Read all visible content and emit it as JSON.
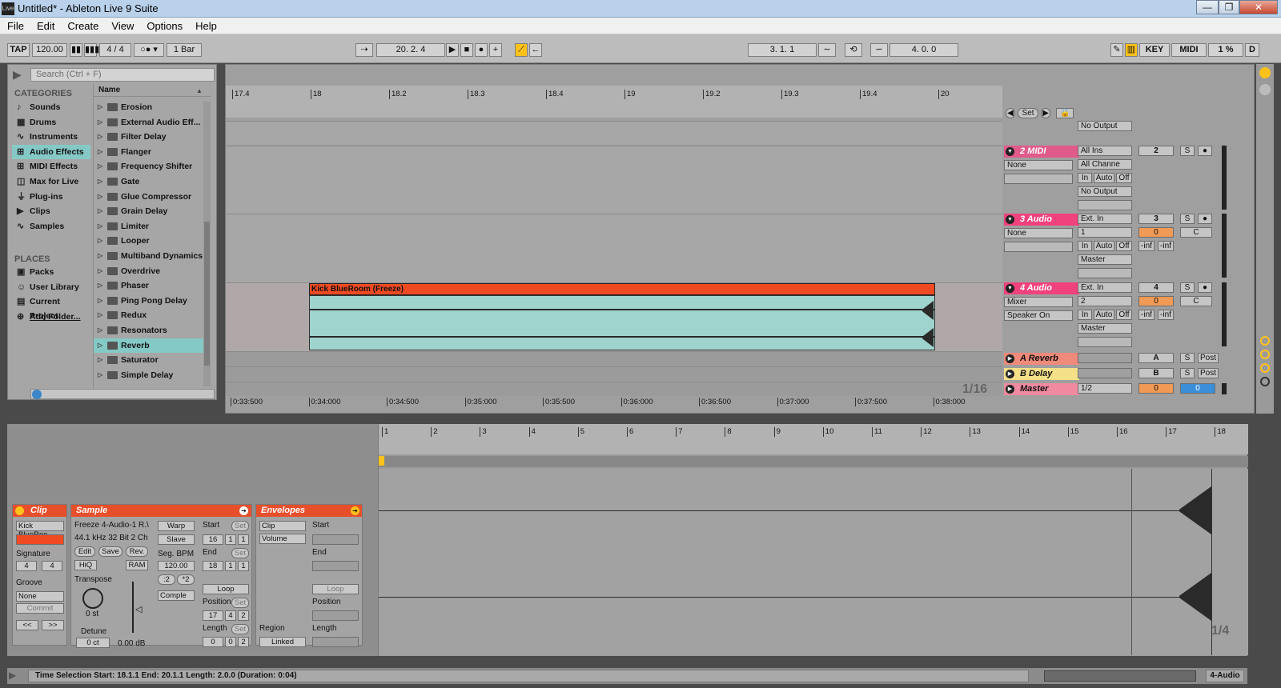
{
  "window": {
    "title": "Untitled* - Ableton Live 9 Suite",
    "app_icon": "Live"
  },
  "menu": [
    "File",
    "Edit",
    "Create",
    "View",
    "Options",
    "Help"
  ],
  "transport": {
    "tap": "TAP",
    "tempo": "120.00",
    "signature": "4 / 4",
    "quantize": "1 Bar",
    "position": "20.   2.   4",
    "loop_start": "3.   1.   1",
    "loop_length": "4.   0.   0",
    "key": "KEY",
    "midi": "MIDI",
    "cpu": "1 %",
    "disk": "D"
  },
  "browser": {
    "search_placeholder": "Search (Ctrl + F)",
    "categories_title": "CATEGORIES",
    "categories": [
      {
        "label": "Sounds",
        "icon": "note-icon"
      },
      {
        "label": "Drums",
        "icon": "grid-icon"
      },
      {
        "label": "Instruments",
        "icon": "wave-icon"
      },
      {
        "label": "Audio Effects",
        "icon": "sliders-icon"
      },
      {
        "label": "MIDI Effects",
        "icon": "sliders-icon"
      },
      {
        "label": "Max for Live",
        "icon": "square-icon"
      },
      {
        "label": "Plug-ins",
        "icon": "plug-icon"
      },
      {
        "label": "Clips",
        "icon": "play-icon"
      },
      {
        "label": "Samples",
        "icon": "wave-icon"
      }
    ],
    "places_title": "PLACES",
    "places": [
      {
        "label": "Packs",
        "icon": "box-icon"
      },
      {
        "label": "User Library",
        "icon": "user-icon"
      },
      {
        "label": "Current Project",
        "icon": "folder-icon"
      },
      {
        "label": "Add Folder...",
        "icon": "plus-icon"
      }
    ],
    "name_header": "Name",
    "items": [
      "Erosion",
      "External Audio Eff...",
      "Filter Delay",
      "Flanger",
      "Frequency Shifter",
      "Gate",
      "Glue Compressor",
      "Grain Delay",
      "Limiter",
      "Looper",
      "Multiband Dynamics",
      "Overdrive",
      "Phaser",
      "Ping Pong Delay",
      "Redux",
      "Resonators",
      "Reverb",
      "Saturator",
      "Simple Delay"
    ],
    "selected_item": "Reverb"
  },
  "arrangement": {
    "ruler_beats": [
      "17.4",
      "18",
      "18.2",
      "18.3",
      "18.4",
      "19",
      "19.2",
      "19.3",
      "19.4",
      "20"
    ],
    "time_labels": [
      "0:33:500",
      "0:34:000",
      "0:34:500",
      "0:35:000",
      "0:35:500",
      "0:36:000",
      "0:36:500",
      "0:37:000",
      "0:37:500",
      "0:38:000"
    ],
    "set_label": "Set",
    "grid": "1/16",
    "clip_name": "Kick BlueRoom (Freeze)",
    "tracks": [
      {
        "name": "2 MIDI",
        "color": "#e05a8c",
        "in1": "All Ins",
        "in2": "All Channe",
        "out": "No Output",
        "num": "2",
        "dev": "None"
      },
      {
        "name": "3 Audio",
        "color": "#f0427c",
        "in1": "Ext. In",
        "in2": "1",
        "out": "Master",
        "num": "3",
        "dev": "None",
        "vol": "0",
        "pan": "C"
      },
      {
        "name": "4 Audio",
        "color": "#f0427c",
        "in1": "Ext. In",
        "in2": "2",
        "out": "Master",
        "num": "4",
        "dev": "Mixer",
        "dev2": "Speaker On",
        "vol": "0",
        "pan": "C"
      }
    ],
    "returns": [
      {
        "name": "A Reverb",
        "color": "#f08a7a",
        "letter": "A",
        "post": "Post"
      },
      {
        "name": "B Delay",
        "color": "#f5e08a",
        "letter": "B",
        "post": "Post"
      }
    ],
    "master": {
      "name": "Master",
      "color": "#f08aa0",
      "cue": "1/2",
      "vol": "0",
      "pan": "0"
    },
    "no_output": "No Output",
    "in": "In",
    "auto": "Auto",
    "off": "Off",
    "inf": "-inf",
    "s": "S"
  },
  "detail": {
    "clip": {
      "title": "Clip",
      "name": "Kick BlueRoo",
      "signature_label": "Signature",
      "sig_num": "4",
      "sig_den": "4",
      "groove_label": "Groove",
      "groove": "None",
      "commit": "Commit"
    },
    "sample": {
      "title": "Sample",
      "file": "Freeze 4-Audio-1 R.\\",
      "format": "44.1 kHz 32 Bit 2 Ch",
      "edit": "Edit",
      "save": "Save",
      "rev": "Rev.",
      "hiq": "HiQ",
      "ram": "RAM",
      "warp": "Warp",
      "slave": "Slave",
      "seg_bpm_label": "Seg. BPM",
      "seg_bpm": "120.00",
      "half": ":2",
      "double": "*2",
      "mode": "Comple",
      "transpose_label": "Transpose",
      "transpose": "0 st",
      "detune_label": "Detune",
      "detune": "0 ct",
      "gain": "0.00 dB",
      "start_label": "Start",
      "start": [
        "16",
        "1",
        "1"
      ],
      "end_label": "End",
      "end": [
        "18",
        "1",
        "1"
      ],
      "loop": "Loop",
      "position_label": "Position",
      "position": [
        "17",
        "4",
        "2"
      ],
      "length_label": "Length",
      "length": [
        "0",
        "0",
        "2"
      ],
      "set": "Set"
    },
    "envelopes": {
      "title": "Envelopes",
      "clip_sel": "Clip",
      "param_sel": "Volume",
      "start_label": "Start",
      "end_label": "End",
      "loop": "Loop",
      "position_label": "Position",
      "region_label": "Region",
      "length_label": "Length",
      "linked": "Linked"
    },
    "ruler": [
      "1",
      "2",
      "3",
      "4",
      "5",
      "6",
      "7",
      "8",
      "9",
      "10",
      "11",
      "12",
      "13",
      "14",
      "15",
      "16",
      "17",
      "18"
    ],
    "grid": "1/4"
  },
  "status": {
    "text": "Time Selection     Start: 18.1.1     End: 20.1.1     Length: 2.0.0  (Duration: 0:04)",
    "track": "4-Audio"
  }
}
